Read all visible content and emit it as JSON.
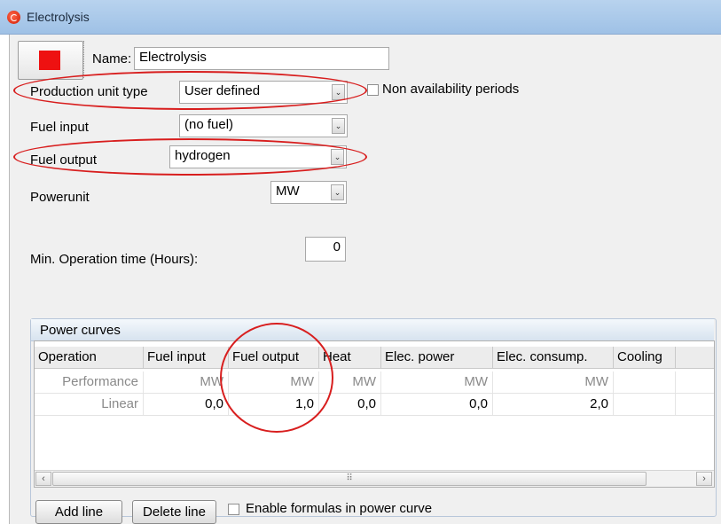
{
  "window": {
    "title": "Electrolysis"
  },
  "colors": {
    "unit_color": "#ee1111",
    "annotation": "#d81e1e"
  },
  "icons": {
    "app": "app-logo-icon",
    "combo": "chevron-down-icon"
  },
  "form": {
    "name_label": "Name:",
    "name_value": "Electrolysis",
    "production_unit_type_label": "Production unit type",
    "production_unit_type_value": "User defined",
    "non_availability_label": "Non availability periods",
    "fuel_input_label": "Fuel input",
    "fuel_input_value": "(no fuel)",
    "fuel_output_label": "Fuel output",
    "fuel_output_value": "hydrogen",
    "powerunit_label": "Powerunit",
    "powerunit_value": "MW",
    "min_operation_label": "Min. Operation time (Hours):",
    "min_operation_value": "0"
  },
  "power_curves": {
    "title": "Power curves",
    "columns": [
      "Operation",
      "Fuel input",
      "Fuel output",
      "Heat",
      "Elec. power",
      "Elec. consump.",
      "Cooling"
    ],
    "rows": [
      {
        "operation": "Performance",
        "fuel_input": "MW",
        "fuel_output": "MW",
        "heat": "MW",
        "elec_power": "MW",
        "elec_consump": "MW",
        "cooling": ""
      },
      {
        "operation": "Linear",
        "fuel_input": "0,0",
        "fuel_output": "1,0",
        "heat": "0,0",
        "elec_power": "0,0",
        "elec_consump": "2,0",
        "cooling": ""
      }
    ],
    "scroll_grip": "⠿",
    "add_line_label": "Add line",
    "delete_line_label": "Delete line",
    "enable_formulas_label": "Enable formulas in power curve"
  }
}
